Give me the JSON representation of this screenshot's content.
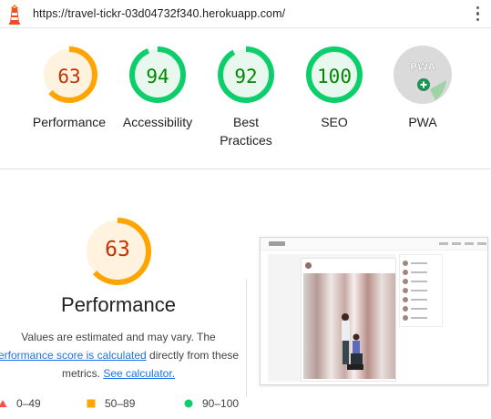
{
  "topbar": {
    "url": "https://travel-tickr-03d04732f340.herokuapp.com/",
    "logo_icon": "lighthouse-icon",
    "menu_icon": "kebab-menu-icon"
  },
  "gauges": [
    {
      "label": "Performance",
      "score": "63",
      "value": 63,
      "color": "#ffa400",
      "fill": "#fff3e0",
      "text_color": "#c33300"
    },
    {
      "label": "Accessibility",
      "score": "94",
      "value": 94,
      "color": "#0cce6b",
      "fill": "#e8f8ee",
      "text_color": "#008800"
    },
    {
      "label": "Best",
      "label2": "Practices",
      "score": "92",
      "value": 92,
      "color": "#0cce6b",
      "fill": "#e8f8ee",
      "text_color": "#008800"
    },
    {
      "label": "SEO",
      "score": "100",
      "value": 100,
      "color": "#0cce6b",
      "fill": "#e8f8ee",
      "text_color": "#008800"
    },
    {
      "label": "PWA",
      "badge": "PWA",
      "icon": "pwa-badge-icon"
    }
  ],
  "performance": {
    "score": "63",
    "value": 63,
    "title": "Performance",
    "desc_line1": "Values are estimated and may vary. The",
    "desc_link1": "erformance score is calculated",
    "desc_line2": " directly from these",
    "desc_line3": "metrics. ",
    "desc_link2": "See calculator."
  },
  "legend": [
    {
      "range": "0–49",
      "icon": "triangle-fail-icon",
      "color": "#ff4e42"
    },
    {
      "range": "50–89",
      "icon": "square-average-icon",
      "color": "#ffa400"
    },
    {
      "range": "90–100",
      "icon": "circle-pass-icon",
      "color": "#0cce6b"
    }
  ],
  "screenshot": {
    "icon": "page-screenshot-thumbnail"
  }
}
